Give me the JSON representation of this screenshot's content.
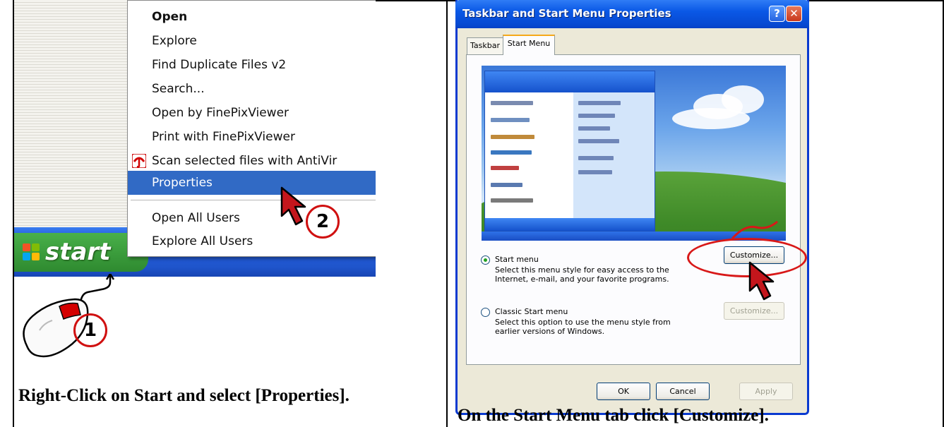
{
  "left_panel": {
    "context_menu": {
      "items": [
        {
          "label": "Open"
        },
        {
          "label": "Explore"
        },
        {
          "label": "Find Duplicate Files v2"
        },
        {
          "label": "Search..."
        },
        {
          "label": "Open by FinePixViewer"
        },
        {
          "label": "Print with FinePixViewer"
        },
        {
          "label": "Scan selected files with AntiVir",
          "icon": "antivir-umbrella-icon"
        },
        {
          "label": "Properties"
        },
        {
          "label": "Open All Users"
        },
        {
          "label": "Explore All Users"
        }
      ],
      "highlight_color": "#316ac5"
    },
    "start_button": {
      "label": "start",
      "color": "#3a9b3b",
      "icon": "windows-flag-icon"
    },
    "taskbar_color": "#245edb",
    "step_badges": [
      "1",
      "2"
    ],
    "caption": "Right-Click on Start and select [Properties]."
  },
  "dialog": {
    "title": "Taskbar and Start Menu Properties",
    "title_buttons": {
      "help": "?",
      "close": "✕"
    },
    "tabs": [
      {
        "label": "Taskbar",
        "active": false
      },
      {
        "label": "Start Menu",
        "active": true
      }
    ],
    "options": [
      {
        "label": "Start menu",
        "selected": true,
        "description_lines": [
          "Select this menu style for easy access to the",
          "Internet, e-mail, and your favorite programs."
        ],
        "button": "Customize...",
        "button_enabled": true
      },
      {
        "label": "Classic Start menu",
        "selected": false,
        "description_lines": [
          "Select this option to use the menu style from",
          "earlier versions of Windows."
        ],
        "button": "Customize...",
        "button_enabled": false
      }
    ],
    "footer_buttons": {
      "ok": "OK",
      "cancel": "Cancel",
      "apply": "Apply"
    },
    "titlebar_color": "#0a58e6",
    "annotation_color": "#d81818"
  },
  "right_caption": "On the Start Menu tab click [Customize]."
}
